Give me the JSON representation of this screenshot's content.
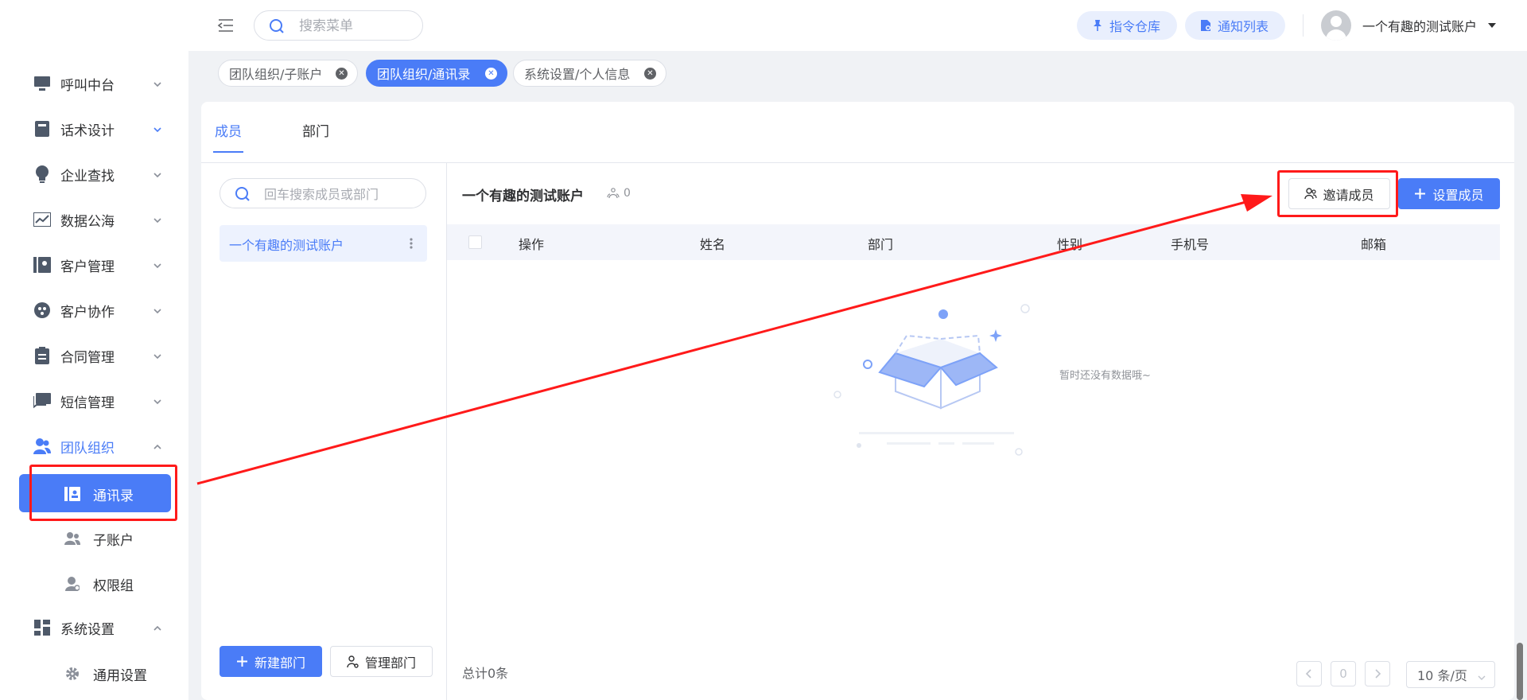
{
  "sidebar": {
    "items": [
      {
        "label": "呼叫中台",
        "icon": "monitor-icon"
      },
      {
        "label": "话术设计",
        "icon": "book-icon"
      },
      {
        "label": "企业查找",
        "icon": "lightbulb-icon"
      },
      {
        "label": "数据公海",
        "icon": "chart-icon"
      },
      {
        "label": "客户管理",
        "icon": "contacts-icon"
      },
      {
        "label": "客户协作",
        "icon": "collab-icon"
      },
      {
        "label": "合同管理",
        "icon": "clipboard-icon"
      },
      {
        "label": "短信管理",
        "icon": "message-icon"
      },
      {
        "label": "团队组织",
        "icon": "team-icon"
      },
      {
        "label": "系统设置",
        "icon": "grid-icon"
      }
    ],
    "team_sub": [
      {
        "label": "通讯录",
        "icon": "address-book-icon"
      },
      {
        "label": "子账户",
        "icon": "subaccount-icon"
      },
      {
        "label": "权限组",
        "icon": "permission-icon"
      }
    ],
    "settings_sub": [
      {
        "label": "通用设置",
        "icon": "gear-icon"
      }
    ]
  },
  "header": {
    "search_placeholder": "搜索菜单",
    "command_repo": "指令仓库",
    "notice_list": "通知列表",
    "user_name": "一个有趣的测试账户"
  },
  "tabs": [
    {
      "label": "团队组织/子账户",
      "active": false
    },
    {
      "label": "团队组织/通讯录",
      "active": true
    },
    {
      "label": "系统设置/个人信息",
      "active": false
    }
  ],
  "panel": {
    "tab_members": "成员",
    "tab_departments": "部门",
    "dept_search_placeholder": "回车搜索成员或部门",
    "dept_root": "一个有趣的测试账户",
    "new_dept": "新建部门",
    "manage_dept": "管理部门",
    "org_title": "一个有趣的测试账户",
    "member_count": "0",
    "invite_member": "邀请成员",
    "set_member": "设置成员",
    "columns": [
      "操作",
      "姓名",
      "部门",
      "性别",
      "手机号",
      "邮箱"
    ],
    "empty_text": "暂时还没有数据哦~",
    "total": "总计0条",
    "current_page": "0",
    "page_size": "10 条/页"
  },
  "colors": {
    "accent": "#4a7cf7",
    "annotation": "#ff1a1a"
  }
}
